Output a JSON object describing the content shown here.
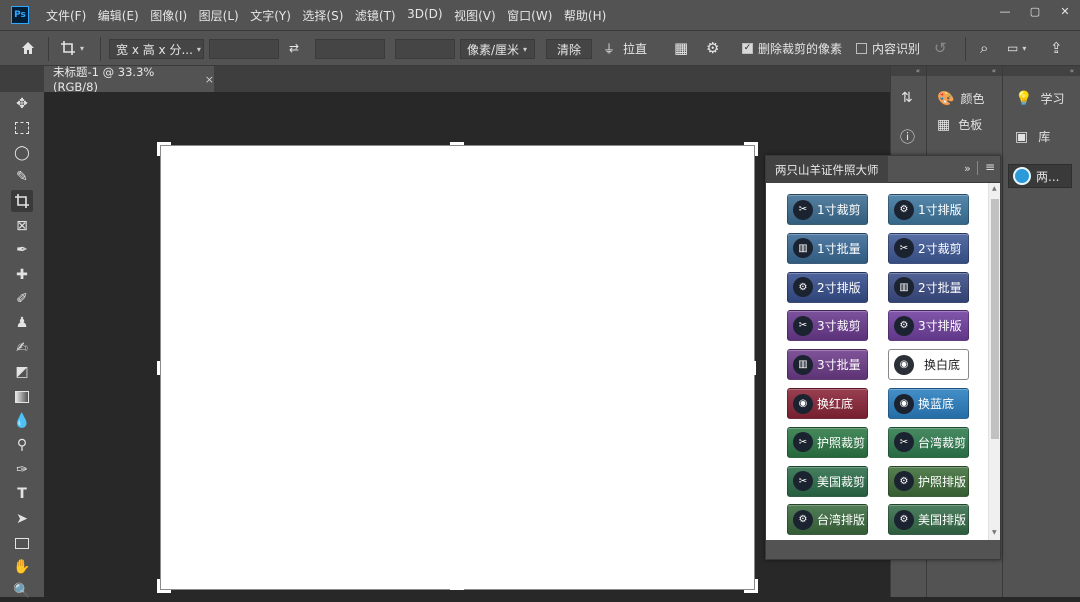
{
  "app": {
    "logo": "Ps"
  },
  "menu": [
    "文件(F)",
    "编辑(E)",
    "图像(I)",
    "图层(L)",
    "文字(Y)",
    "选择(S)",
    "滤镜(T)",
    "3D(D)",
    "视图(V)",
    "窗口(W)",
    "帮助(H)"
  ],
  "window_controls": {
    "minimize": "—",
    "restore": "▢",
    "close": "✕"
  },
  "options": {
    "ratio_select": "宽 x 高 x 分...",
    "width_value": "",
    "height_value": "",
    "resolution_value": "",
    "unit_select": "像素/厘米",
    "clear_label": "清除",
    "straighten_label": "拉直",
    "delete_cropped_label": "删除裁剪的像素",
    "delete_cropped_checked": true,
    "content_aware_label": "内容识别",
    "content_aware_checked": false
  },
  "document": {
    "tab_title": "未标题-1 @ 33.3%(RGB/8)",
    "close": "×"
  },
  "tools": [
    "move",
    "marquee",
    "lasso",
    "quick-select",
    "crop",
    "frame",
    "eyedropper",
    "healing",
    "brush",
    "stamp",
    "history-brush",
    "eraser",
    "gradient",
    "blur",
    "dodge",
    "pen",
    "type",
    "path-select",
    "rectangle",
    "hand",
    "zoom"
  ],
  "right_panels": {
    "color_label": "颜色",
    "swatches_label": "色板",
    "learn_label": "学习",
    "libraries_label": "库",
    "plugin_short_label": "两..."
  },
  "plugin": {
    "title": "两只山羊证件照大师",
    "buttons_left": [
      {
        "label": "1寸裁剪",
        "icon": "scissors-icon",
        "color": "#3d6e93"
      },
      {
        "label": "1寸批量",
        "icon": "chart-icon",
        "color": "#3a6a96"
      },
      {
        "label": "2寸排版",
        "icon": "gears-icon",
        "color": "#374f8e"
      },
      {
        "label": "3寸裁剪",
        "icon": "scissors-icon",
        "color": "#6a3a8f"
      },
      {
        "label": "3寸批量",
        "icon": "chart-icon",
        "color": "#6e3c8a"
      },
      {
        "label": "换红底",
        "icon": "film-icon",
        "color": "#8a2538"
      },
      {
        "label": "护照裁剪",
        "icon": "scissors-icon",
        "color": "#2d7a46"
      },
      {
        "label": "美国裁剪",
        "icon": "scissors-icon",
        "color": "#2c6e4a"
      },
      {
        "label": "台湾排版",
        "icon": "gears-icon",
        "color": "#3b6b3f"
      }
    ],
    "buttons_right": [
      {
        "label": "1寸排版",
        "icon": "gears-icon",
        "color": "#3f78a0"
      },
      {
        "label": "2寸裁剪",
        "icon": "scissors-icon",
        "color": "#3f5a98"
      },
      {
        "label": "2寸批量",
        "icon": "chart-icon",
        "color": "#3b4d86"
      },
      {
        "label": "3寸排版",
        "icon": "gears-icon",
        "color": "#7140a0"
      },
      {
        "label": "换白底",
        "icon": "film-icon",
        "color": "#ffffff"
      },
      {
        "label": "换蓝底",
        "icon": "film-icon",
        "color": "#2b80c2"
      },
      {
        "label": "台湾裁剪",
        "icon": "scissors-icon",
        "color": "#2f7c4e"
      },
      {
        "label": "护照排版",
        "icon": "gears-icon",
        "color": "#3f6e3a"
      },
      {
        "label": "美国排版",
        "icon": "gears-icon",
        "color": "#356d49"
      }
    ]
  }
}
